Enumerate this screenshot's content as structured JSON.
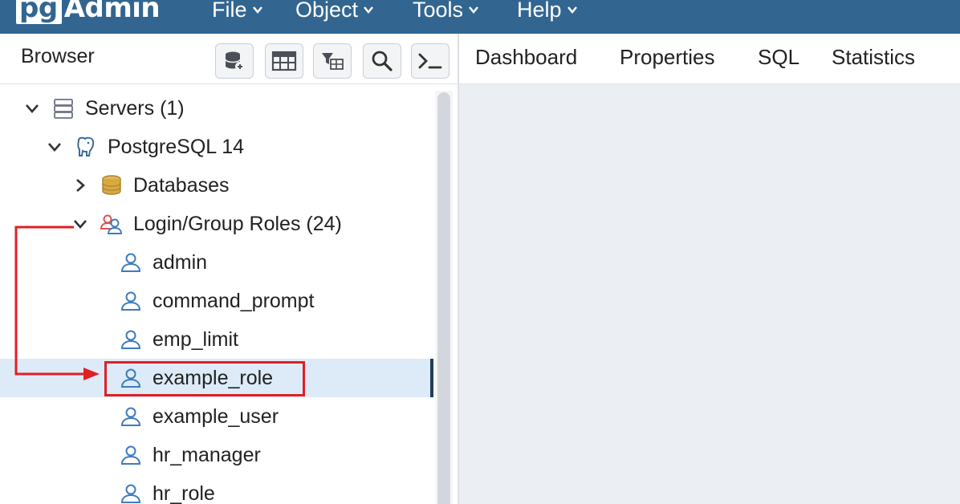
{
  "app": {
    "logo_prefix": "pg",
    "logo_suffix": "Admin",
    "menu": [
      {
        "label": "File"
      },
      {
        "label": "Object"
      },
      {
        "label": "Tools"
      },
      {
        "label": "Help"
      }
    ],
    "colors": {
      "menubar": "#326690",
      "selection": "#dcebf7",
      "annotation": "#e01f26",
      "content_bg": "#ebeef3"
    }
  },
  "browser": {
    "title": "Browser",
    "toolbar": [
      {
        "icon": "query-tool-icon"
      },
      {
        "icon": "view-data-icon"
      },
      {
        "icon": "filtered-rows-icon"
      },
      {
        "icon": "search-objects-icon"
      },
      {
        "icon": "psql-tool-icon"
      }
    ]
  },
  "tabs": [
    {
      "label": "Dashboard"
    },
    {
      "label": "Properties"
    },
    {
      "label": "SQL"
    },
    {
      "label": "Statistics"
    }
  ],
  "tree": [
    {
      "label": "Servers (1)",
      "icon": "servers-icon",
      "expanded": true
    },
    {
      "label": "PostgreSQL 14",
      "icon": "postgres-elephant-icon",
      "expanded": true
    },
    {
      "label": "Databases",
      "icon": "databases-icon",
      "expanded": false
    },
    {
      "label": "Login/Group Roles (24)",
      "icon": "group-roles-icon",
      "expanded": true
    },
    {
      "label": "admin",
      "icon": "role-icon"
    },
    {
      "label": "command_prompt",
      "icon": "role-icon"
    },
    {
      "label": "emp_limit",
      "icon": "role-icon"
    },
    {
      "label": "example_role",
      "icon": "role-icon",
      "selected": true
    },
    {
      "label": "example_user",
      "icon": "role-icon"
    },
    {
      "label": "hr_manager",
      "icon": "role-icon"
    },
    {
      "label": "hr_role",
      "icon": "role-icon"
    }
  ]
}
